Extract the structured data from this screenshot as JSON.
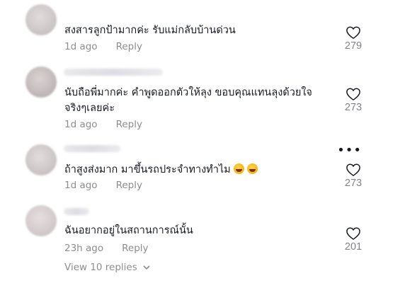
{
  "comments": [
    {
      "text": "สงสารลูกป้ามากค่ะ รับแม่กลับบ้านด่วน",
      "time": "1d ago",
      "reply_label": "Reply",
      "likes": "279"
    },
    {
      "text_line1": "นับถือพี่มากค่ะ คำพูดออกตัวให้ลุง ขอบคุณแทนลุงด้วยใจ",
      "text_line2": "จริงๆเลยค่ะ",
      "time": "1d ago",
      "reply_label": "Reply",
      "likes": "273"
    },
    {
      "text": "ถ้าสูงส่งมาก มาขึ้นรถประจำทางทำไม",
      "emoji_icons": [
        "rolling-on-floor-laughing-emoji",
        "rolling-on-floor-laughing-emoji"
      ],
      "time": "1d ago",
      "reply_label": "Reply",
      "likes": "273",
      "more_label": "•••"
    },
    {
      "text": "ฉันอยากอยู่ในสถานการณ์นั้น",
      "time": "23h ago",
      "reply_label": "Reply",
      "likes": "201"
    }
  ],
  "view_replies_label": "View 10 replies",
  "icons": {
    "like": "heart-outline-icon",
    "expand": "chevron-down-icon"
  },
  "colors": {
    "text": "#161823",
    "secondary": "#8a8b91"
  }
}
